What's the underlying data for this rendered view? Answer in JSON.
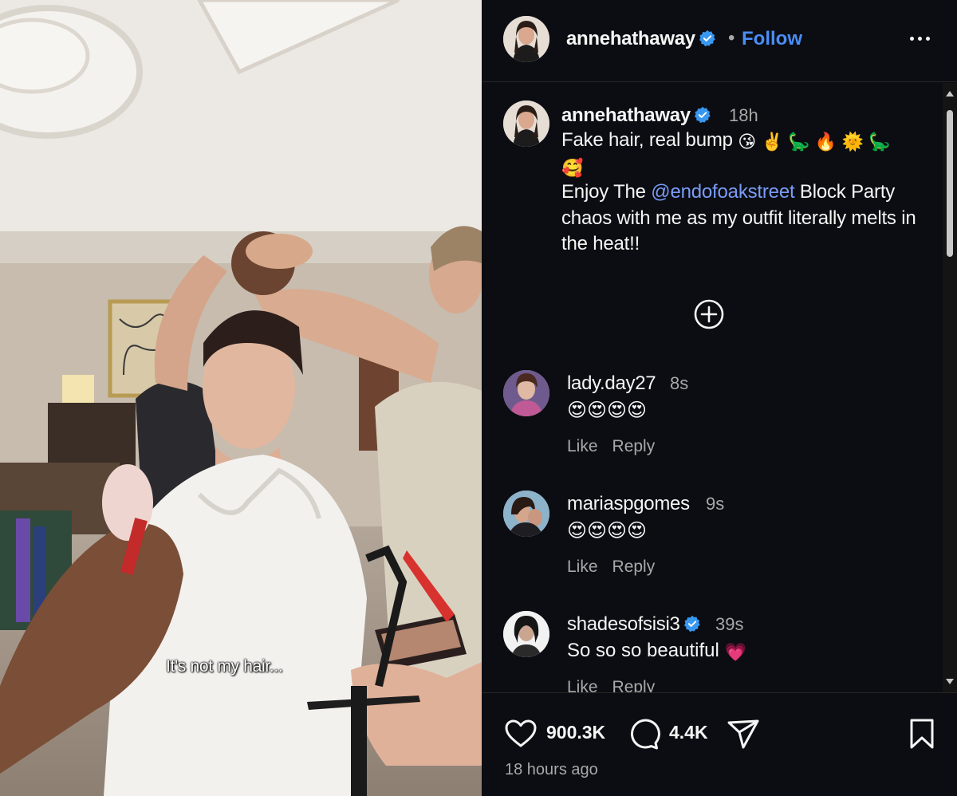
{
  "media": {
    "caption_overlay": "It's not my hair..."
  },
  "header": {
    "username": "annehathaway",
    "separator": "•",
    "follow_label": "Follow",
    "more_icon": "more-horizontal-icon"
  },
  "post": {
    "username": "annehathaway",
    "time": "18h",
    "text_line1": "Fake hair, real bump",
    "emojis_line1": [
      "😘",
      "✌️",
      "🦕",
      "🔥",
      "🌞",
      "🦕"
    ],
    "emojis_line2": [
      "🥰"
    ],
    "text_enjoy": "Enjoy The ",
    "mention": "@endofoakstreet",
    "text_rest": " Block Party chaos with me as my outfit literally melts in the heat!!"
  },
  "load_more_icon": "plus-circle-icon",
  "comments": [
    {
      "username": "lady.day27",
      "time": "8s",
      "text": "😍😍😍😍",
      "verified": false,
      "like": "Like",
      "reply": "Reply"
    },
    {
      "username": "mariaspgomes",
      "time": "9s",
      "text": "😍😍😍😍",
      "verified": false,
      "like": "Like",
      "reply": "Reply"
    },
    {
      "username": "shadesofsisi3",
      "time": "39s",
      "text": "So so so beautiful",
      "text_emoji": "💗",
      "verified": true,
      "like": "Like",
      "reply": "Reply"
    }
  ],
  "footer": {
    "likes": "900.3K",
    "comments": "4.4K",
    "posted": "18 hours ago"
  },
  "colors": {
    "panel_bg": "#0b0d12",
    "accent": "#4a8df6",
    "mention": "#7a9cf8",
    "verified": "#3897f0",
    "muted": "#a8a8a8"
  }
}
